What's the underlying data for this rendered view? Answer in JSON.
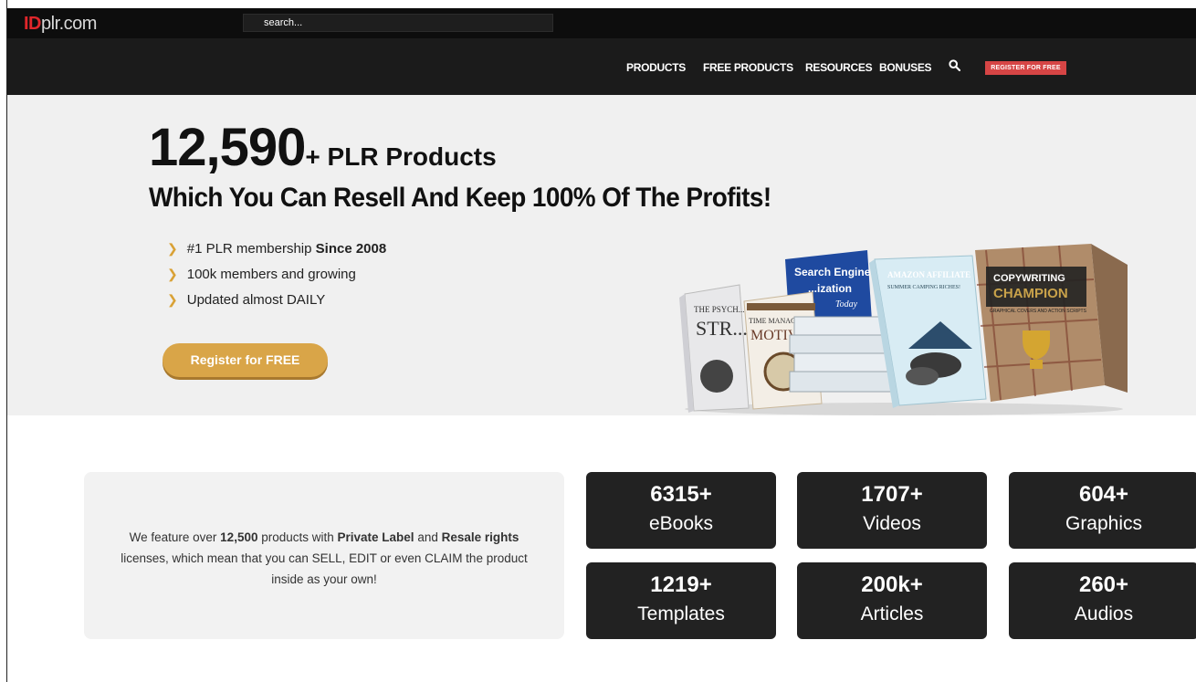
{
  "header": {
    "logo_id": "ID",
    "logo_rest": "plr.com",
    "search_placeholder": "search..."
  },
  "nav": {
    "items": [
      "PRODUCTS",
      "FREE PRODUCTS",
      "RESOURCES",
      "BONUSES"
    ],
    "search_icon": "search-icon",
    "register_label": "REGISTER FOR FREE"
  },
  "hero": {
    "count": "12,590",
    "count_suffix": "+ PLR Products",
    "subtitle": "Which You Can Resell And Keep 100% Of The Profits!",
    "bullets": [
      {
        "text": "#1 PLR membership ",
        "bold": "Since 2008"
      },
      {
        "text": "100k members and growing",
        "bold": ""
      },
      {
        "text": "Updated almost DAILY",
        "bold": ""
      }
    ],
    "button_label": "Register for FREE",
    "book_titles": {
      "seo_line1": "Search Engine",
      "seo_line2": "...ization",
      "seo_line3": "Today",
      "amazon_line1": "AMAZON AFFILIATE",
      "amazon_line2": "SUMMER CAMPING RICHES!",
      "copy_line1": "COPYWRITING",
      "copy_line2": "CHAMPION",
      "copy_line3": "GRAPHICAL COVERS AND ACTION SCRIPTS",
      "psych_line1": "THE PSYCH...",
      "psych_line2": "STR...",
      "time_line1": "TIME MANAGEMENT &",
      "time_line2": "MOTIVA..."
    }
  },
  "info": {
    "p1": "We feature over ",
    "b1": "12,500",
    "p2": " products with ",
    "b2": "Private Label",
    "p3": " and ",
    "b3": "Resale rights",
    "p4": " licenses, which mean that you can SELL, EDIT or even CLAIM the product inside as your own!"
  },
  "stats": [
    {
      "num": "6315+",
      "label": "eBooks"
    },
    {
      "num": "1707+",
      "label": "Videos"
    },
    {
      "num": "604+",
      "label": "Graphics"
    },
    {
      "num": "1219+",
      "label": "Templates"
    },
    {
      "num": "200k+",
      "label": "Articles"
    },
    {
      "num": "260+",
      "label": "Audios"
    }
  ],
  "colors": {
    "accent_gold": "#d9a548",
    "register_red": "#d64545",
    "logo_red": "#e0262b",
    "dark": "#222222"
  }
}
